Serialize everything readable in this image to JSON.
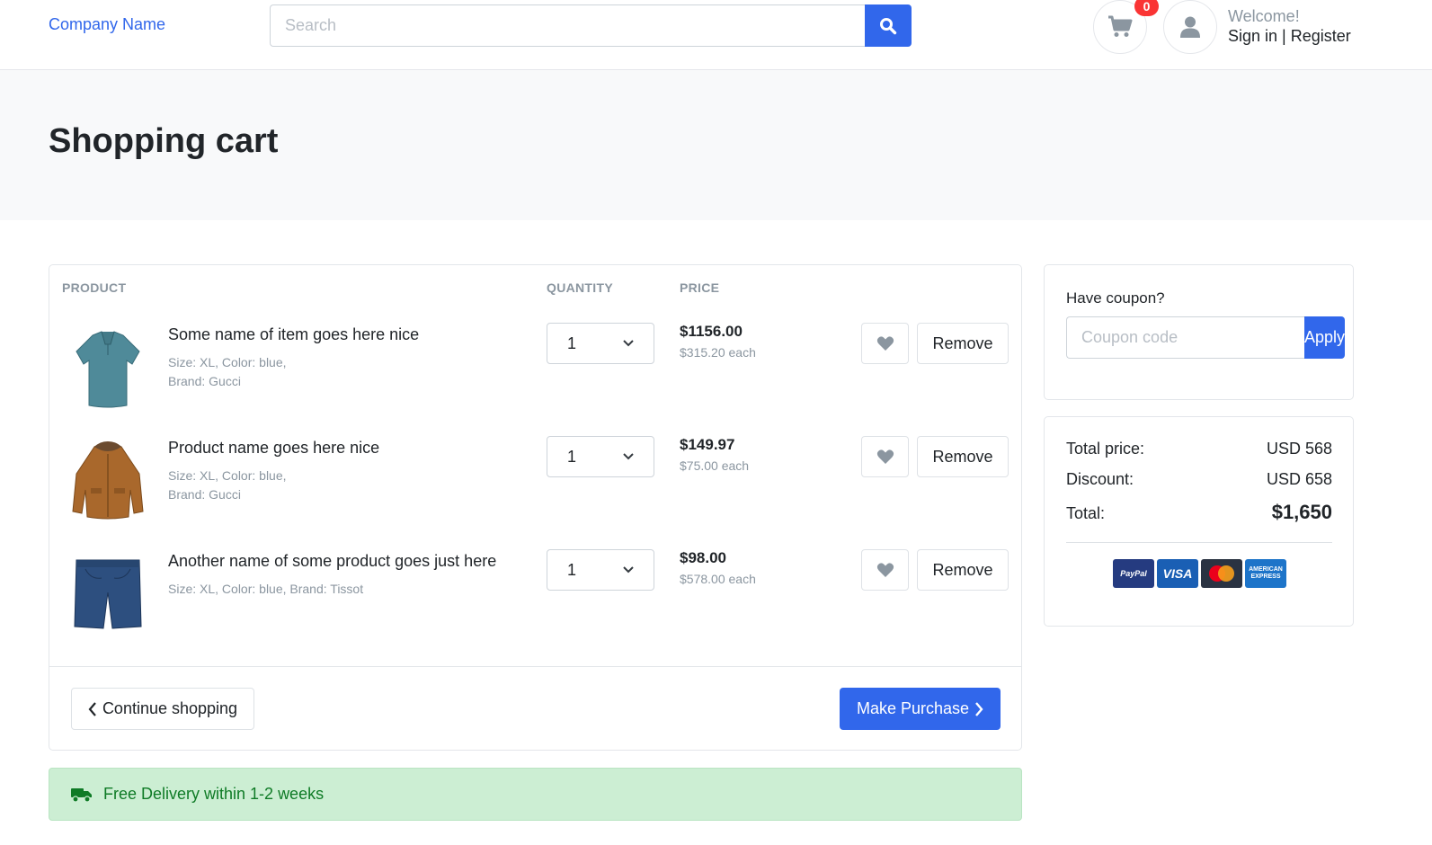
{
  "header": {
    "brand": "Company Name",
    "search": {
      "placeholder": "Search"
    },
    "cart_count": "0",
    "welcome": "Welcome!",
    "sign_in": "Sign in",
    "separator": " | ",
    "register": "Register"
  },
  "page": {
    "title": "Shopping cart"
  },
  "cart": {
    "headers": {
      "product": "PRODUCT",
      "quantity": "QUANTITY",
      "price": "PRICE"
    },
    "items": [
      {
        "name": "Some name of item goes here nice",
        "meta_line1": "Size: XL, Color: blue,",
        "meta_line2": "Brand: Gucci",
        "quantity": "1",
        "price": "$1156.00",
        "price_each": "$315.20 each",
        "remove_label": "Remove",
        "image": "polo-shirt-icon"
      },
      {
        "name": "Product name goes here nice",
        "meta_line1": "Size: XL, Color: blue,",
        "meta_line2": "Brand: Gucci",
        "quantity": "1",
        "price": "$149.97",
        "price_each": "$75.00 each",
        "remove_label": "Remove",
        "image": "jacket-icon"
      },
      {
        "name": "Another name of some product goes just here",
        "meta_line1": "Size: XL, Color: blue, Brand: Tissot",
        "meta_line2": "",
        "quantity": "1",
        "price": "$98.00",
        "price_each": "$578.00 each",
        "remove_label": "Remove",
        "image": "shorts-icon"
      }
    ],
    "continue_label": "Continue shopping",
    "purchase_label": "Make Purchase"
  },
  "delivery": {
    "text": "Free Delivery within 1-2 weeks"
  },
  "coupon": {
    "label": "Have coupon?",
    "placeholder": "Coupon code",
    "apply_label": "Apply"
  },
  "summary": {
    "total_price_label": "Total price:",
    "total_price_value": "USD 568",
    "discount_label": "Discount:",
    "discount_value": "USD 658",
    "total_label": "Total:",
    "total_value": "$1,650"
  },
  "payments": {
    "paypal": "PayPal",
    "visa": "VISA",
    "amex_line1": "AMERICAN",
    "amex_line2": "EXPRESS"
  },
  "colors": {
    "primary": "#3167eb",
    "badge": "#fa3434",
    "success_bg": "#cceed3",
    "success_text": "#0f7b26"
  }
}
